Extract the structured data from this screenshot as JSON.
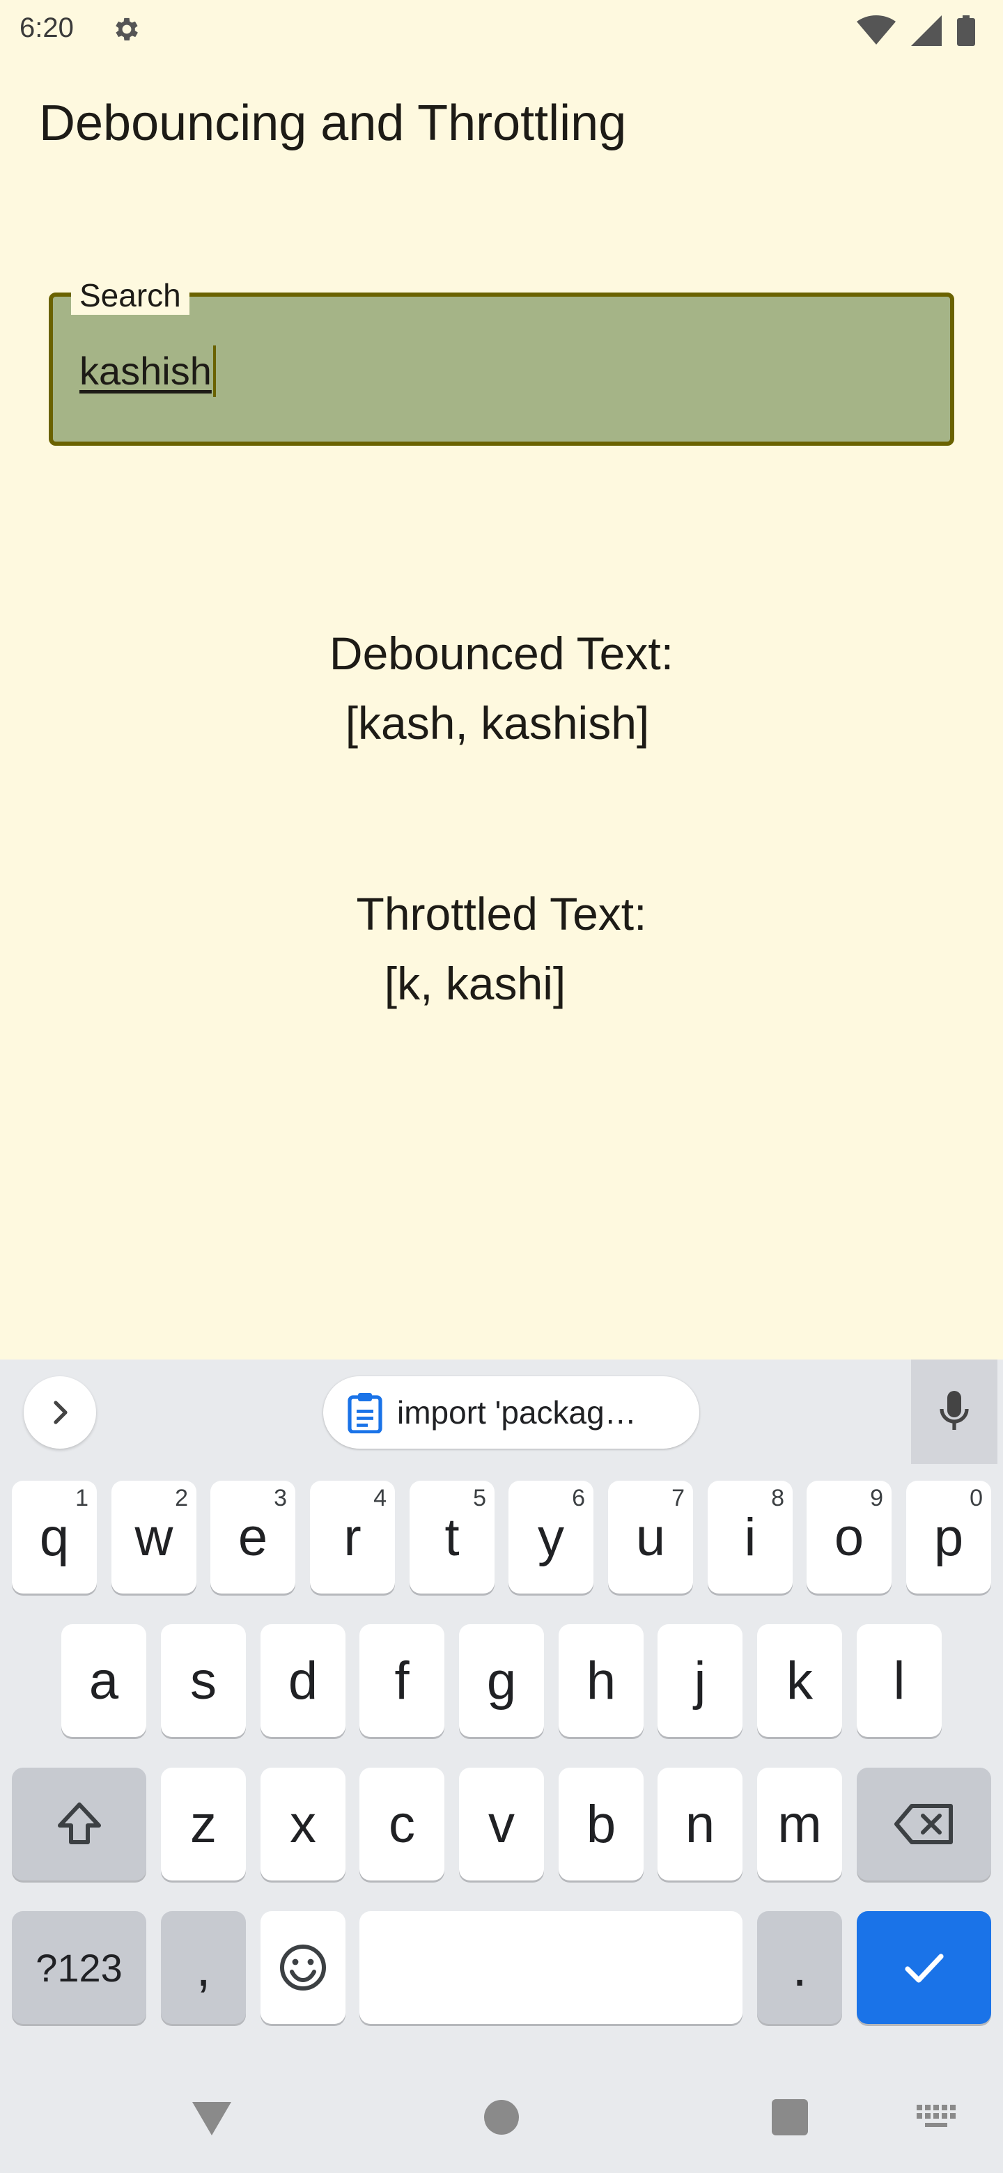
{
  "status_bar": {
    "time": "6:20"
  },
  "app": {
    "title": "Debouncing and Throttling"
  },
  "search": {
    "label": "Search",
    "value": "kashish"
  },
  "debounced": {
    "label": "Debounced Text:",
    "value": "[kash, kashish]"
  },
  "throttled": {
    "label": "Throttled Text:",
    "value": "[k, kashi]"
  },
  "keyboard": {
    "clipboard_suggestion": "import 'packag…",
    "row1": [
      {
        "key": "q",
        "hint": "1"
      },
      {
        "key": "w",
        "hint": "2"
      },
      {
        "key": "e",
        "hint": "3"
      },
      {
        "key": "r",
        "hint": "4"
      },
      {
        "key": "t",
        "hint": "5"
      },
      {
        "key": "y",
        "hint": "6"
      },
      {
        "key": "u",
        "hint": "7"
      },
      {
        "key": "i",
        "hint": "8"
      },
      {
        "key": "o",
        "hint": "9"
      },
      {
        "key": "p",
        "hint": "0"
      }
    ],
    "row2": [
      "a",
      "s",
      "d",
      "f",
      "g",
      "h",
      "j",
      "k",
      "l"
    ],
    "row3": [
      "z",
      "x",
      "c",
      "v",
      "b",
      "n",
      "m"
    ],
    "symbols_label": "?123",
    "comma_label": ",",
    "period_label": "."
  },
  "colors": {
    "background": "#fef9df",
    "search_fill": "#a5b487",
    "search_border": "#6a6200",
    "keyboard_bg": "#e8eaed",
    "action_key": "#1a73e8"
  }
}
